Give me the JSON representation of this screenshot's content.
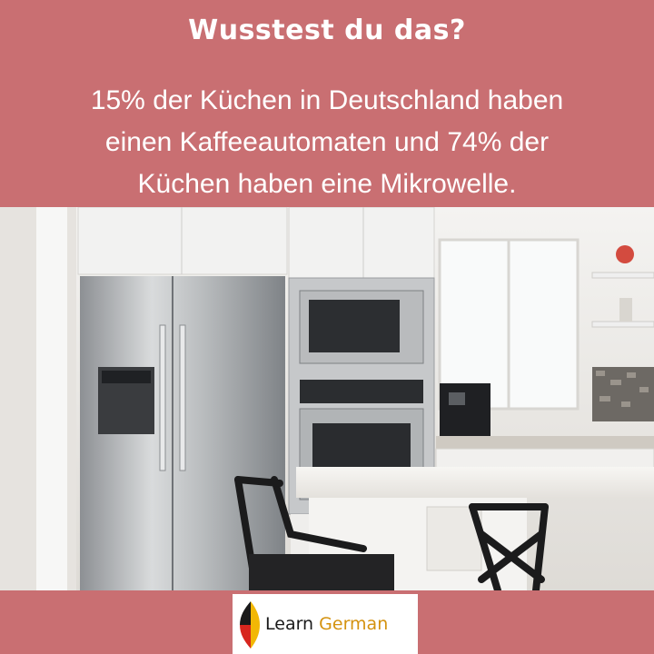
{
  "header": {
    "title": "Wusstest du das?",
    "fact_line1": "15% der Küchen in Deutschland haben",
    "fact_line2": "einen Kaffeeautomaten und 74% der",
    "fact_line3": "Küchen haben eine Mikrowelle."
  },
  "photo": {
    "subject": "kitchen-photo"
  },
  "logo": {
    "word1": "Learn",
    "word2": "German"
  },
  "colors": {
    "background": "#c96f72",
    "text": "#ffffff",
    "logo_black": "#1a1a1a",
    "logo_red": "#d7261e",
    "logo_gold": "#f2b705"
  }
}
